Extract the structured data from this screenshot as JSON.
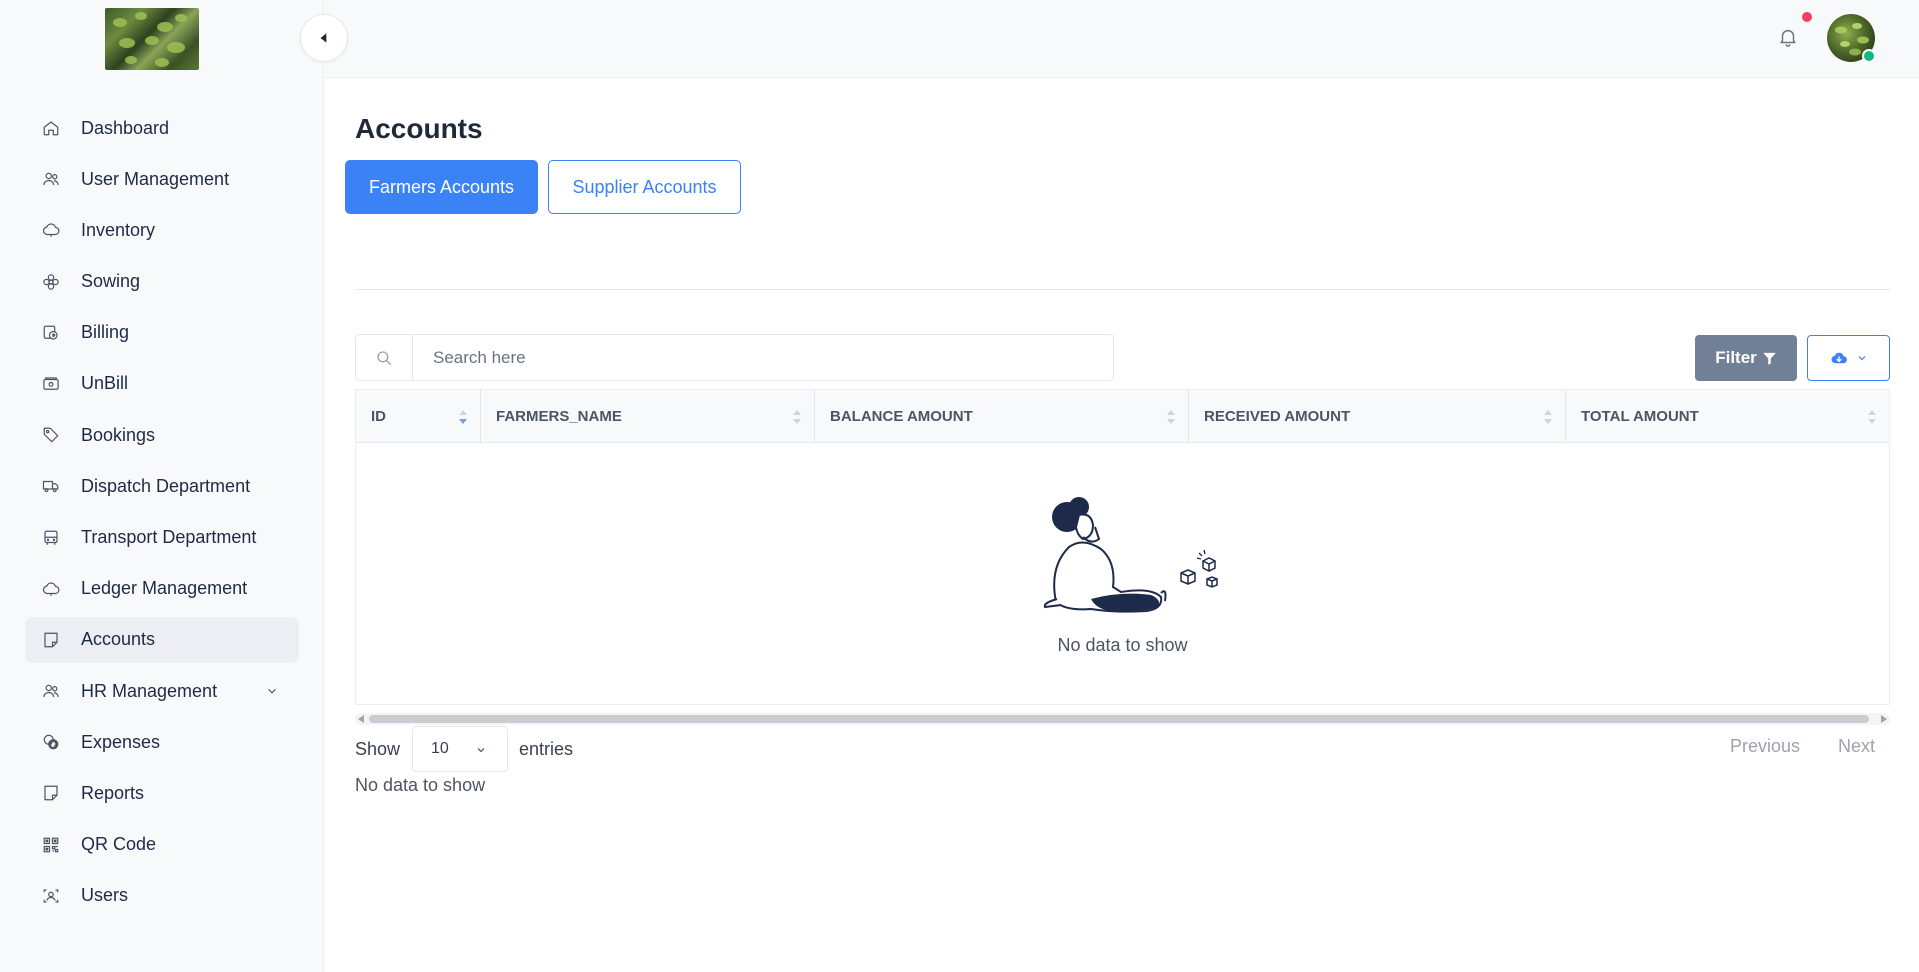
{
  "sidebar": {
    "items": [
      {
        "label": "Dashboard",
        "icon": "home-icon"
      },
      {
        "label": "User Management",
        "icon": "users-icon"
      },
      {
        "label": "Inventory",
        "icon": "cloud-icon"
      },
      {
        "label": "Sowing",
        "icon": "flower-icon"
      },
      {
        "label": "Billing",
        "icon": "billing-icon"
      },
      {
        "label": "UnBill",
        "icon": "cash-icon"
      },
      {
        "label": "Bookings",
        "icon": "tag-icon"
      },
      {
        "label": "Dispatch Department",
        "icon": "truck-icon"
      },
      {
        "label": "Transport Department",
        "icon": "bus-icon"
      },
      {
        "label": "Ledger Management",
        "icon": "cloud-icon"
      },
      {
        "label": "Accounts",
        "icon": "note-icon",
        "active": true
      },
      {
        "label": "HR Management",
        "icon": "users-icon",
        "has_children": true
      },
      {
        "label": "Expenses",
        "icon": "coins-icon"
      },
      {
        "label": "Reports",
        "icon": "note-icon"
      },
      {
        "label": "QR Code",
        "icon": "qr-code-icon"
      },
      {
        "label": "Users",
        "icon": "user-badge-icon"
      }
    ]
  },
  "page": {
    "title": "Accounts",
    "tabs": [
      {
        "label": "Farmers Accounts",
        "active": true
      },
      {
        "label": "Supplier Accounts",
        "active": false
      }
    ]
  },
  "toolbar": {
    "search_placeholder": "Search here",
    "filter_label": "Filter"
  },
  "table": {
    "columns": [
      "ID",
      "FARMERS_NAME",
      "BALANCE AMOUNT",
      "RECEIVED AMOUNT",
      "TOTAL AMOUNT"
    ],
    "rows": [],
    "empty_text": "No data to show"
  },
  "pagination": {
    "show_label": "Show",
    "page_size": "10",
    "entries_label": "entries",
    "info_text": "No data to show",
    "previous_label": "Previous",
    "next_label": "Next"
  },
  "colors": {
    "accent": "#3b82f6",
    "filter_button": "#718096",
    "notification_dot": "#f43f5e",
    "online_status": "#10b981"
  }
}
